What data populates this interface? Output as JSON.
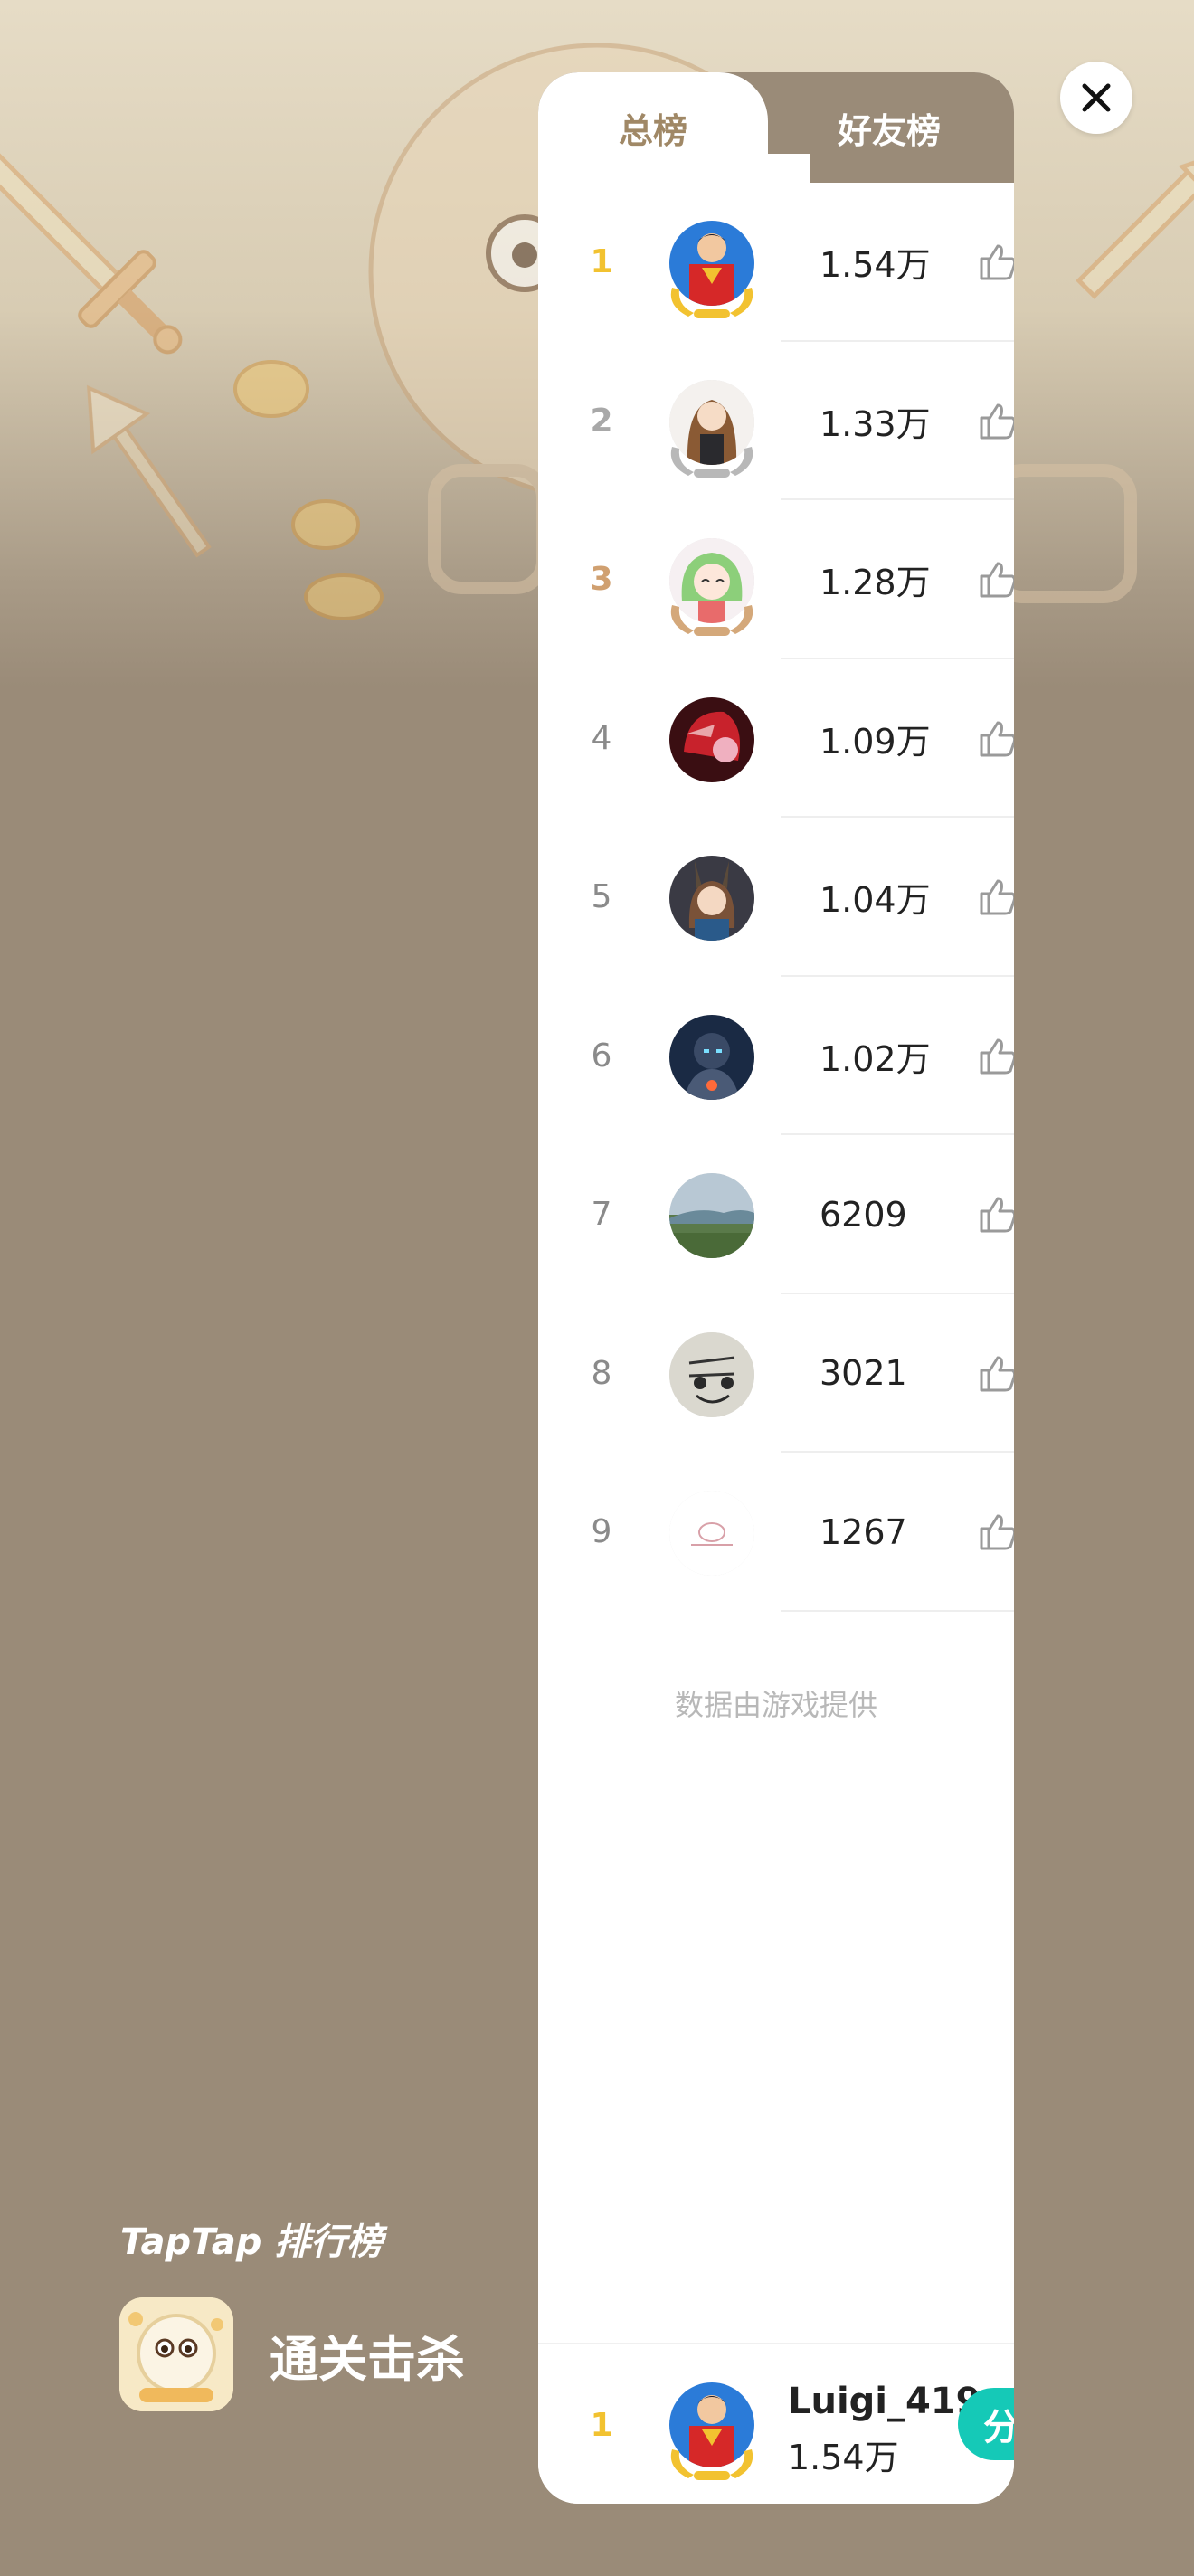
{
  "tabs": {
    "total": "总榜",
    "friends": "好友榜"
  },
  "leaderboard": [
    {
      "rank": "1",
      "score": "1.54万",
      "rank_color": "#f2c230",
      "avatar": "superman-avatar"
    },
    {
      "rank": "2",
      "score": "1.33万",
      "rank_color": "#a8a8a8",
      "avatar": "anime-girl-avatar"
    },
    {
      "rank": "3",
      "score": "1.28万",
      "rank_color": "#d0a070",
      "avatar": "green-hair-girl-avatar"
    },
    {
      "rank": "4",
      "score": "1.09万",
      "rank_color": "#8a8a8a",
      "avatar": "red-helmet-avatar"
    },
    {
      "rank": "5",
      "score": "1.04万",
      "rank_color": "#8a8a8a",
      "avatar": "bunny-ear-girl-avatar"
    },
    {
      "rank": "6",
      "score": "1.02万",
      "rank_color": "#8a8a8a",
      "avatar": "armored-hero-avatar"
    },
    {
      "rank": "7",
      "score": "6209",
      "rank_color": "#8a8a8a",
      "avatar": "landscape-avatar"
    },
    {
      "rank": "8",
      "score": "3021",
      "rank_color": "#8a8a8a",
      "avatar": "smiley-face-avatar"
    },
    {
      "rank": "9",
      "score": "1267",
      "rank_color": "#8a8a8a",
      "avatar": "pink-sketch-avatar"
    }
  ],
  "footer_note": "数据由游戏提供",
  "me": {
    "rank": "1",
    "name": "Luigi_419",
    "score": "1.54万",
    "share_label": "分"
  },
  "brand": {
    "title": "TapTap 排行榜",
    "game_name": "通关击杀"
  },
  "colors": {
    "background": "#9a8b78",
    "accent_share": "#15c9b7",
    "gold": "#f2c230"
  }
}
